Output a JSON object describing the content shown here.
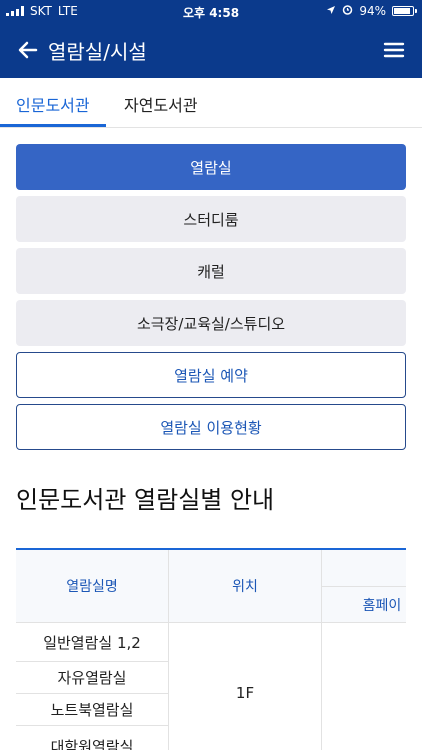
{
  "status": {
    "carrier": "SKT",
    "network": "LTE",
    "time": "오후 4:58",
    "battery": "94%",
    "battery_level": 0.94
  },
  "appbar": {
    "title": "열람실/시설"
  },
  "tabs": [
    {
      "label": "인문도서관",
      "active": true
    },
    {
      "label": "자연도서관",
      "active": false
    }
  ],
  "buttons": {
    "reading_room": "열람실",
    "study_room": "스터디룸",
    "carrel": "캐럴",
    "theater": "소극장/교육실/스튜디오",
    "reservation": "열람실 예약",
    "status": "열람실 이용현황"
  },
  "section": {
    "title": "인문도서관 열람실별 안내"
  },
  "table": {
    "headers": {
      "name": "열람실명",
      "location": "위치",
      "homepage_partial": "홈페이"
    },
    "rows": [
      "일반열람실 1,2",
      "자유열람실",
      "노트북열람실",
      "대학원열람실"
    ],
    "location_value": "1F"
  },
  "colors": {
    "header_bg": "#0b3a8c",
    "accent": "#1a66d6",
    "primary_button": "#3565c5"
  }
}
